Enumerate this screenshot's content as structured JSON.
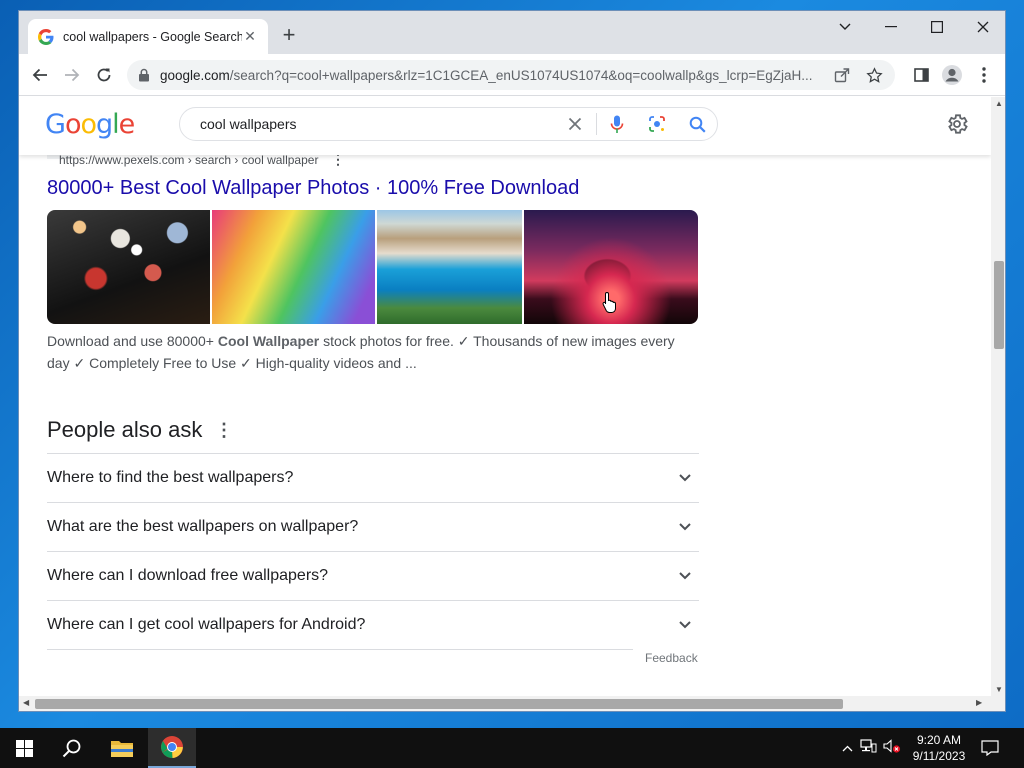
{
  "browser": {
    "tab_title": "cool wallpapers - Google Search",
    "url_host": "google.com",
    "url_rest": "/search?q=cool+wallpapers&rlz=1C1GCEA_enUS1074US1074&oq=coolwallp&gs_lcrp=EgZjaH..."
  },
  "google": {
    "logo_text": "Google",
    "query": "cool wallpapers"
  },
  "result": {
    "cite": "https://www.pexels.com › search › cool wallpaper",
    "title": "80000+ Best Cool Wallpaper Photos · 100% Free Download",
    "snippet_pre": "Download and use 80000+ ",
    "snippet_bold": "Cool Wallpaper",
    "snippet_post": " stock photos for free. ✓ Thousands of new images every day ✓ Completely Free to Use ✓ High-quality videos and ..."
  },
  "people_also_ask": {
    "heading": "People also ask",
    "questions": [
      "Where to find the best wallpapers?",
      "What are the best wallpapers on wallpaper?",
      "Where can I download free wallpapers?",
      "Where can I get cool wallpapers for Android?"
    ],
    "feedback": "Feedback"
  },
  "taskbar": {
    "time": "9:20 AM",
    "date": "9/11/2023"
  },
  "colors": {
    "link": "#1a0dab",
    "accent_blue": "#4285f4",
    "taskbar_bg": "#101010"
  }
}
